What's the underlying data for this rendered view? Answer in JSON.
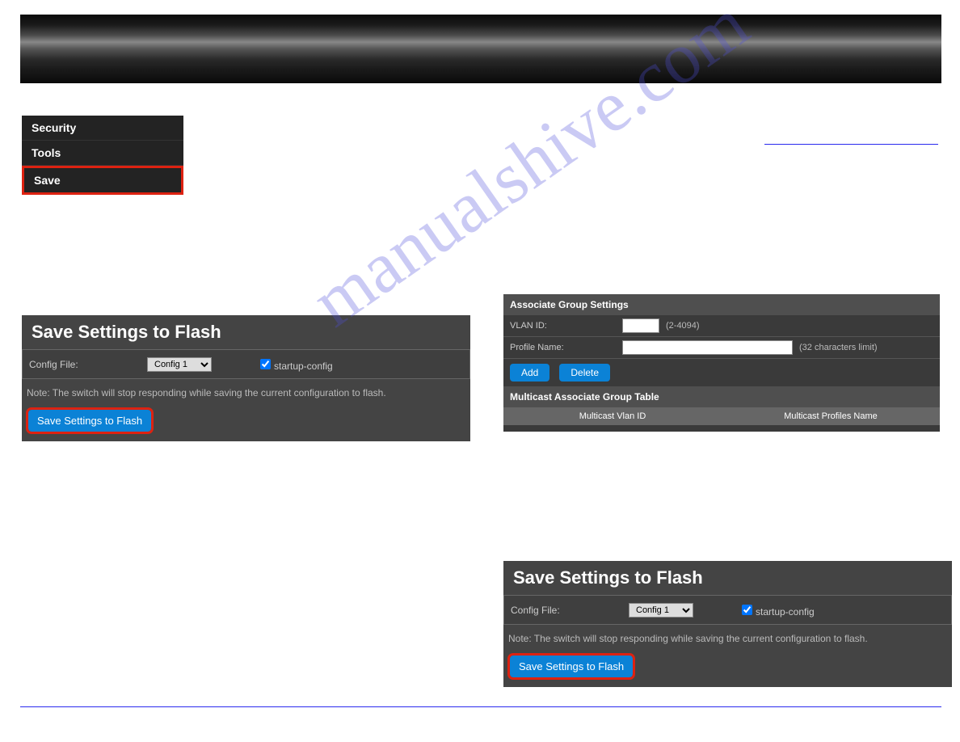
{
  "sidebar": {
    "items": [
      "Security",
      "Tools",
      "Save"
    ]
  },
  "watermark": "manualshive.com",
  "save_panel": {
    "title": "Save Settings to Flash",
    "config_file_label": "Config File:",
    "config_option": "Config 1",
    "startup_label": "startup-config",
    "note": "Note: The switch will stop responding while saving the current configuration to flash.",
    "button": "Save Settings to Flash"
  },
  "assoc": {
    "header": "Associate Group Settings",
    "vlan_label": "VLAN ID:",
    "vlan_hint": "(2-4094)",
    "profile_label": "Profile Name:",
    "profile_hint": "(32 characters limit)",
    "add": "Add",
    "delete": "Delete",
    "table_header": "Multicast Associate Group Table",
    "col1": "Multicast Vlan ID",
    "col2": "Multicast Profiles Name"
  }
}
